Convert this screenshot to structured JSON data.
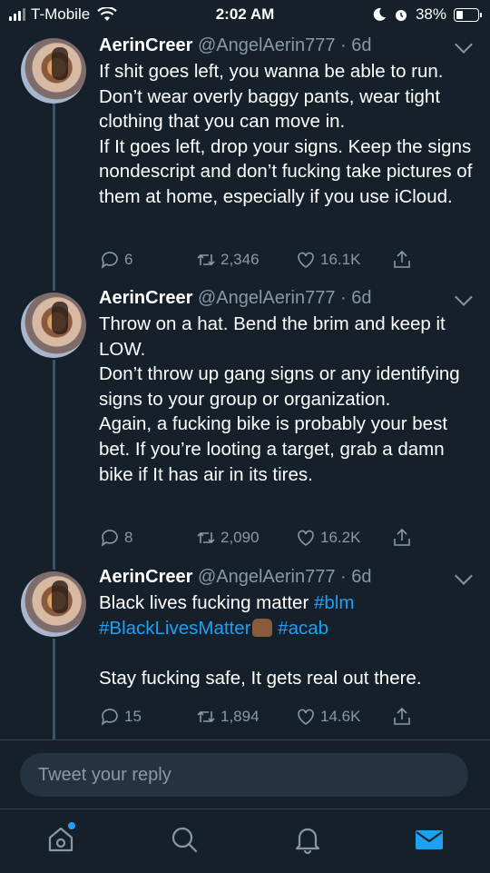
{
  "status_bar": {
    "carrier": "T-Mobile",
    "time": "2:02 AM",
    "battery": "38%"
  },
  "tweets": [
    {
      "name": "AerinCreer",
      "handle": "@AngelAerin777",
      "age": "6d",
      "lines": [
        "If shit goes left, you wanna be able to run. Don’t wear overly baggy pants, wear tight clothing that you can move in.",
        "If It goes left, drop your signs. Keep the signs nondescript and don’t fucking take pictures of them at home, especially if you use iCloud."
      ],
      "replies": "6",
      "retweets": "2,346",
      "likes": "16.1K"
    },
    {
      "name": "AerinCreer",
      "handle": "@AngelAerin777",
      "age": "6d",
      "lines": [
        "Throw on a hat. Bend the brim and keep it LOW.",
        "Don’t throw up gang signs or any identifying signs to your group or organization.",
        "Again, a fucking bike is probably your best bet. If you’re looting a target, grab a damn bike if It has air in its tires."
      ],
      "replies": "8",
      "retweets": "2,090",
      "likes": "16.2K"
    },
    {
      "name": "AerinCreer",
      "handle": "@AngelAerin777",
      "age": "6d",
      "text_prefix": "Black lives fucking matter ",
      "hashtag1": "#blm",
      "hashtag2": "#BlackLivesMatter",
      "hashtag3": "#acab",
      "line_last": "Stay fucking safe, It gets real out there.",
      "replies": "15",
      "retweets": "1,894",
      "likes": "14.6K"
    }
  ],
  "reply_box": {
    "placeholder": "Tweet your reply"
  },
  "tab_bar": {
    "tabs": [
      "home-icon",
      "search-icon",
      "notifications-icon",
      "messages-icon"
    ],
    "active_color": "#1da1f2"
  },
  "colors": {
    "background": "#15202b",
    "muted": "#8899a6",
    "accent": "#1da1f2"
  }
}
